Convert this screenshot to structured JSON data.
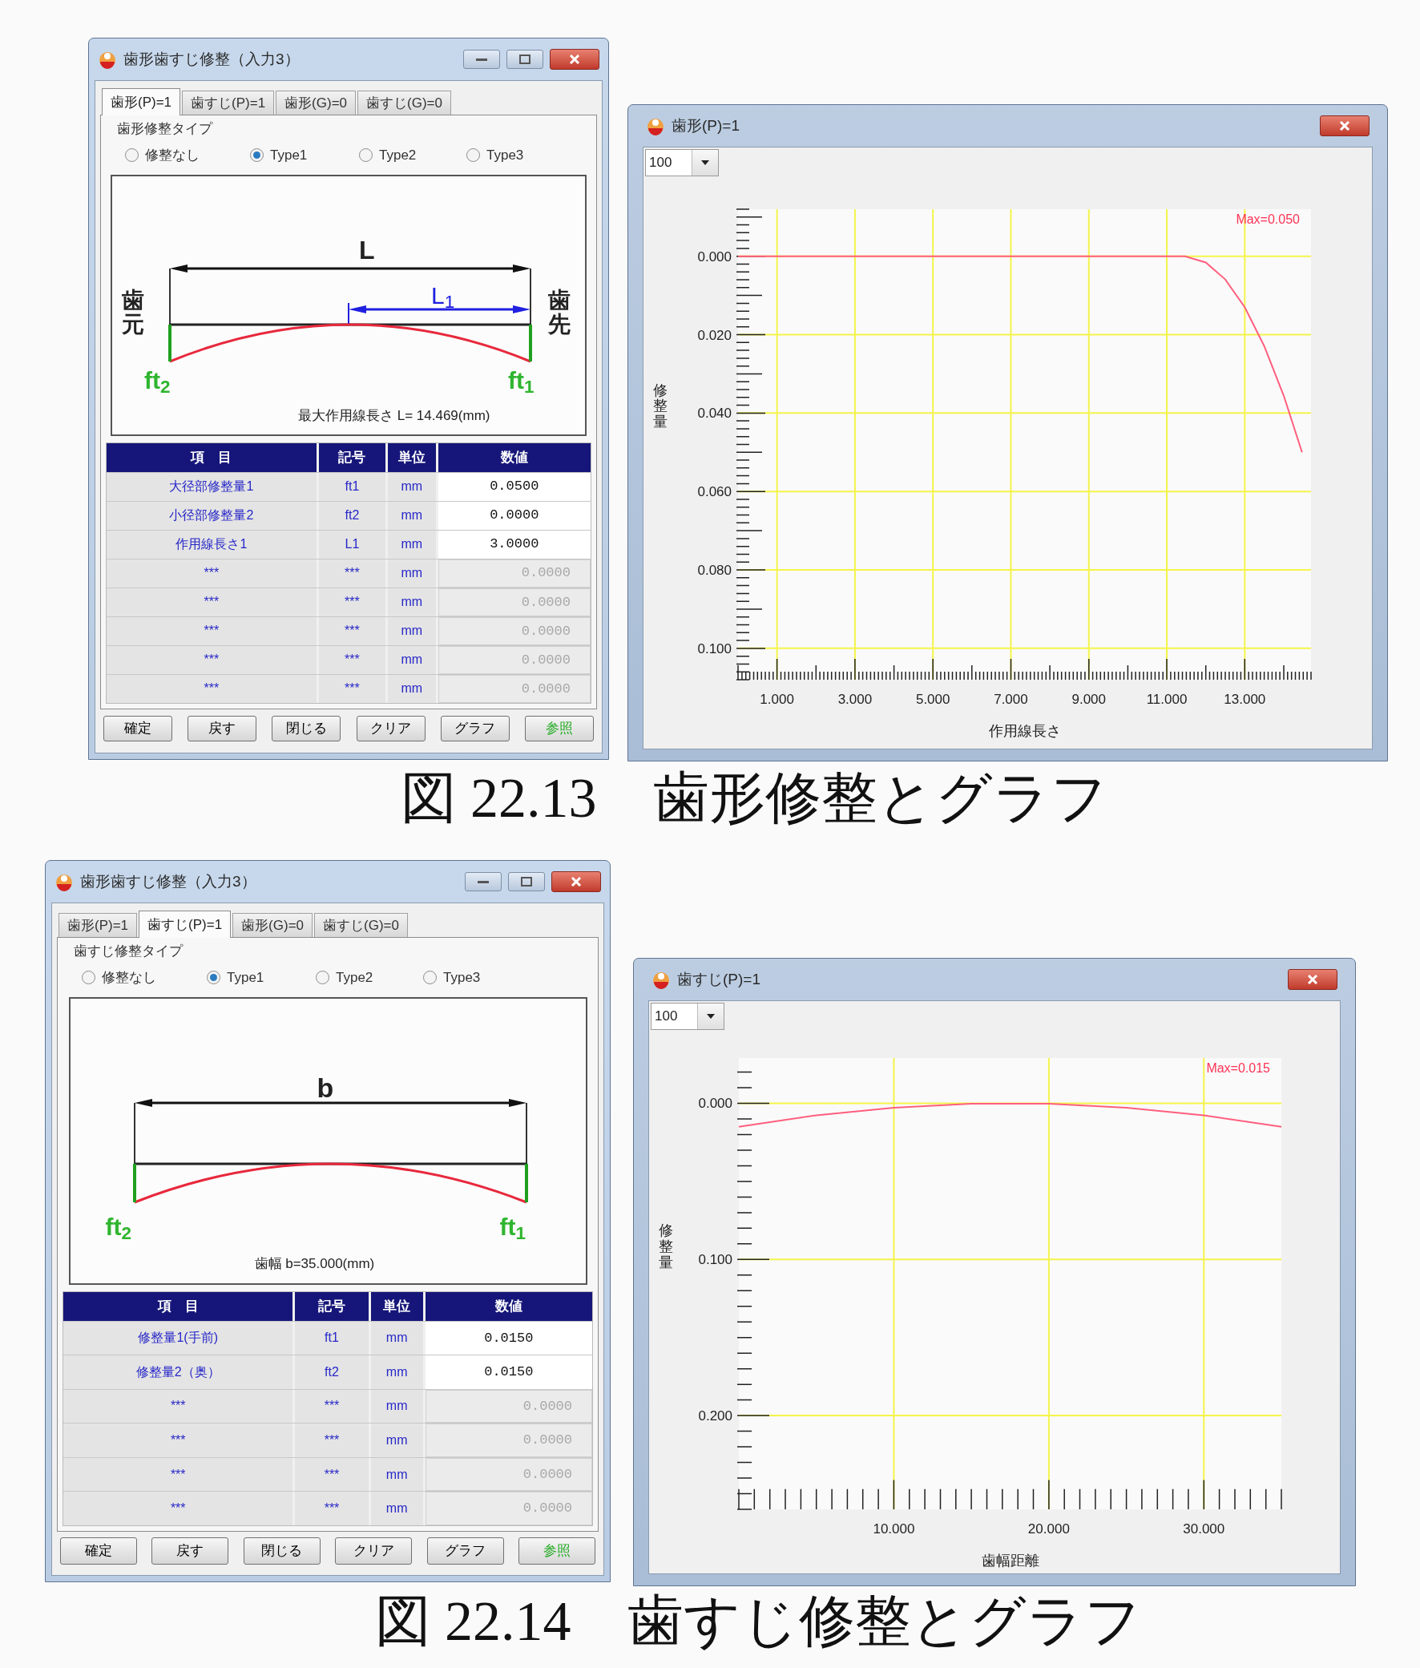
{
  "figures": [
    {
      "input_window": {
        "title": "歯形歯すじ修整（入力3）",
        "tabs": [
          {
            "label": "歯形(P)=1",
            "selected": true
          },
          {
            "label": "歯すじ(P)=1",
            "selected": false
          },
          {
            "label": "歯形(G)=0",
            "selected": false
          },
          {
            "label": "歯すじ(G)=0",
            "selected": false
          }
        ],
        "group_label": "歯形修整タイプ",
        "options": [
          {
            "label": "修整なし",
            "selected": false
          },
          {
            "label": "Type1",
            "selected": true
          },
          {
            "label": "Type2",
            "selected": false
          },
          {
            "label": "Type3",
            "selected": false
          }
        ],
        "diagram": {
          "kind": "profile",
          "length_label": "L",
          "sub_length_label": "L$_{1}$",
          "left_label": "歯元",
          "right_label": "歯先",
          "left_mod": "ft$_{2}$",
          "right_mod": "ft$_{1}$",
          "note": "最大作用線長さ L= 14.469(mm)"
        },
        "table": {
          "columns": [
            "項　目",
            "記号",
            "単位",
            "数値"
          ],
          "rows": [
            {
              "item": "大径部修整量1",
              "symbol": "ft1",
              "unit": "mm",
              "value": "0.0500",
              "disabled": false
            },
            {
              "item": "小径部修整量2",
              "symbol": "ft2",
              "unit": "mm",
              "value": "0.0000",
              "disabled": false
            },
            {
              "item": "作用線長さ1",
              "symbol": "L1",
              "unit": "mm",
              "value": "3.0000",
              "disabled": false
            },
            {
              "item": "***",
              "symbol": "***",
              "unit": "mm",
              "value": "0.0000",
              "disabled": true
            },
            {
              "item": "***",
              "symbol": "***",
              "unit": "mm",
              "value": "0.0000",
              "disabled": true
            },
            {
              "item": "***",
              "symbol": "***",
              "unit": "mm",
              "value": "0.0000",
              "disabled": true
            },
            {
              "item": "***",
              "symbol": "***",
              "unit": "mm",
              "value": "0.0000",
              "disabled": true
            },
            {
              "item": "***",
              "symbol": "***",
              "unit": "mm",
              "value": "0.0000",
              "disabled": true
            }
          ]
        },
        "buttons": [
          {
            "label": "確定",
            "color": "#000000"
          },
          {
            "label": "戻す",
            "color": "#000000"
          },
          {
            "label": "閉じる",
            "color": "#000000"
          },
          {
            "label": "クリア",
            "color": "#000000"
          },
          {
            "label": "グラフ",
            "color": "#000000"
          },
          {
            "label": "参照",
            "color": "#22aa22"
          }
        ]
      },
      "graph_window": {
        "title": "歯形(P)=1",
        "scale": "100",
        "chart_data": {
          "type": "line",
          "grid": true,
          "xlabel": "作用線長さ",
          "ylabel": "修整量",
          "x": [
            0,
            11.469,
            12,
            12.5,
            13,
            13.5,
            14,
            14.469
          ],
          "series": [
            {
              "color": "#ff5f7e",
              "values": [
                0,
                0,
                0.0016,
                0.0059,
                0.013,
                0.0229,
                0.0356,
                0.05
              ]
            }
          ],
          "xlim": [
            0,
            14.7
          ],
          "ylim": [
            0.108,
            -0.012
          ],
          "xticks": [
            {
              "value": 1,
              "label": "1.000"
            },
            {
              "value": 3,
              "label": "3.000"
            },
            {
              "value": 5,
              "label": "5.000"
            },
            {
              "value": 7,
              "label": "7.000"
            },
            {
              "value": 9,
              "label": "9.000"
            },
            {
              "value": 11,
              "label": "11.000"
            },
            {
              "value": 13,
              "label": "13.000"
            }
          ],
          "yticks": [
            {
              "value": 0,
              "label": "0.000"
            },
            {
              "value": 0.02,
              "label": "0.020"
            },
            {
              "value": 0.04,
              "label": "0.040"
            },
            {
              "value": 0.06,
              "label": "0.060"
            },
            {
              "value": 0.08,
              "label": "0.080"
            },
            {
              "value": 0.1,
              "label": "0.100"
            }
          ],
          "annotations": [
            {
              "text": "Max=0.050"
            }
          ]
        }
      },
      "caption": "図 22.13　歯形修整とグラフ"
    },
    {
      "input_window": {
        "title": "歯形歯すじ修整（入力3）",
        "tabs": [
          {
            "label": "歯形(P)=1",
            "selected": false
          },
          {
            "label": "歯すじ(P)=1",
            "selected": true
          },
          {
            "label": "歯形(G)=0",
            "selected": false
          },
          {
            "label": "歯すじ(G)=0",
            "selected": false
          }
        ],
        "group_label": "歯すじ修整タイプ",
        "options": [
          {
            "label": "修整なし",
            "selected": false
          },
          {
            "label": "Type1",
            "selected": true
          },
          {
            "label": "Type2",
            "selected": false
          },
          {
            "label": "Type3",
            "selected": false
          }
        ],
        "diagram": {
          "kind": "lead",
          "length_label": "b",
          "left_mod": "ft$_{2}$",
          "right_mod": "ft$_{1}$",
          "note": "歯幅 b=35.000(mm)"
        },
        "table": {
          "columns": [
            "項　目",
            "記号",
            "単位",
            "数値"
          ],
          "rows": [
            {
              "item": "修整量1(手前)",
              "symbol": "ft1",
              "unit": "mm",
              "value": "0.0150",
              "disabled": false
            },
            {
              "item": "修整量2（奥）",
              "symbol": "ft2",
              "unit": "mm",
              "value": "0.0150",
              "disabled": false
            },
            {
              "item": "***",
              "symbol": "***",
              "unit": "mm",
              "value": "0.0000",
              "disabled": true
            },
            {
              "item": "***",
              "symbol": "***",
              "unit": "mm",
              "value": "0.0000",
              "disabled": true
            },
            {
              "item": "***",
              "symbol": "***",
              "unit": "mm",
              "value": "0.0000",
              "disabled": true
            },
            {
              "item": "***",
              "symbol": "***",
              "unit": "mm",
              "value": "0.0000",
              "disabled": true
            }
          ]
        },
        "buttons": [
          {
            "label": "確定",
            "color": "#000000"
          },
          {
            "label": "戻す",
            "color": "#000000"
          },
          {
            "label": "閉じる",
            "color": "#000000"
          },
          {
            "label": "クリア",
            "color": "#000000"
          },
          {
            "label": "グラフ",
            "color": "#000000"
          },
          {
            "label": "参照",
            "color": "#22aa22"
          }
        ]
      },
      "graph_window": {
        "title": "歯すじ(P)=1",
        "scale": "100",
        "chart_data": {
          "type": "line",
          "grid": true,
          "xlabel": "歯幅距離",
          "ylabel": "修整量",
          "x": [
            0,
            5,
            10,
            15,
            20,
            25,
            30,
            35
          ],
          "series": [
            {
              "color": "#ff5f7e",
              "values": [
                0.015,
                0.0077,
                0.0028,
                0.0003,
                0.0003,
                0.0028,
                0.0077,
                0.015
              ]
            }
          ],
          "xlim": [
            0,
            35
          ],
          "ylim": [
            0.26,
            -0.029
          ],
          "xticks": [
            {
              "value": 10,
              "label": "10.000"
            },
            {
              "value": 20,
              "label": "20.000"
            },
            {
              "value": 30,
              "label": "30.000"
            }
          ],
          "yticks": [
            {
              "value": 0,
              "label": "0.000"
            },
            {
              "value": 0.1,
              "label": "0.100"
            },
            {
              "value": 0.2,
              "label": "0.200"
            }
          ],
          "annotations": [
            {
              "text": "Max=0.015"
            }
          ]
        }
      },
      "caption": "図 22.14　歯すじ修整とグラフ"
    }
  ]
}
